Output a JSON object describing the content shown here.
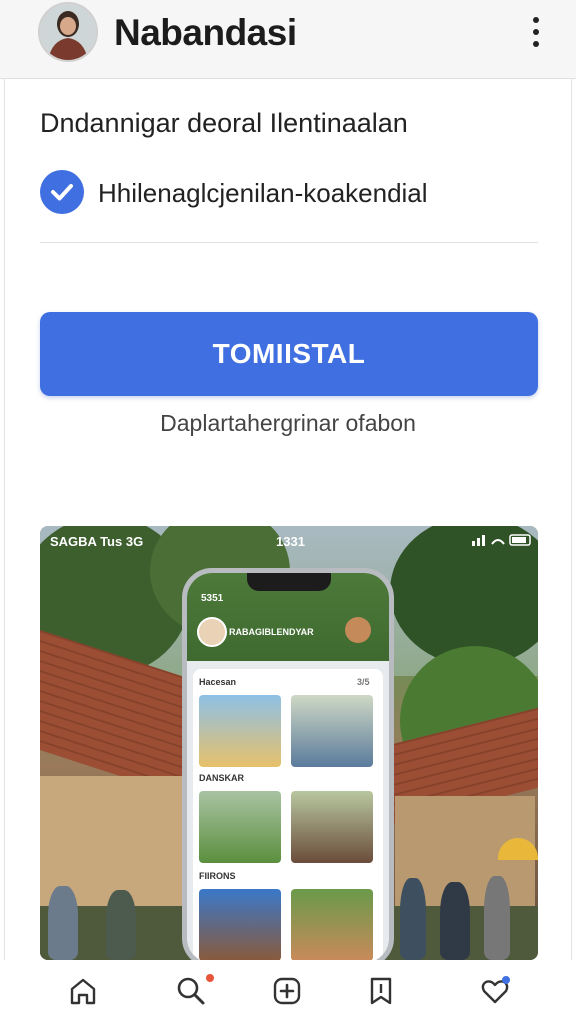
{
  "header": {
    "title": "Nabandasi",
    "avatar_icon": "profile-photo",
    "menu_icon": "more-vertical-icon"
  },
  "content": {
    "subtitle": "Dndannigar deoral Ilentinaalan",
    "checkbox": {
      "checked": true,
      "label": "Hhilenaglcjenilan-koakendial",
      "icon": "check-icon"
    },
    "primary_button_label": "TOMIISTAL",
    "helper_text": "Daplartahergrinar ofabon"
  },
  "preview": {
    "status_left": "SAGBA  Tus 3G",
    "status_time": "1331",
    "phone": {
      "status": "5351",
      "title": "RABAGIBLENDYAR",
      "sections": [
        "Hacesan",
        "DANSKAR",
        "FIIRONS"
      ],
      "section_meta": "3/5"
    }
  },
  "bottom_nav": {
    "items": [
      {
        "name": "home",
        "icon": "home-icon"
      },
      {
        "name": "search",
        "icon": "search-icon",
        "badge": true
      },
      {
        "name": "add",
        "icon": "add-icon"
      },
      {
        "name": "bookmarks",
        "icon": "bookmark-icon"
      },
      {
        "name": "favorites",
        "icon": "heart-icon",
        "badge": true
      }
    ]
  },
  "colors": {
    "accent": "#3f6fe0",
    "badge": "#e8553b",
    "header_bg": "#f6f6f7"
  }
}
